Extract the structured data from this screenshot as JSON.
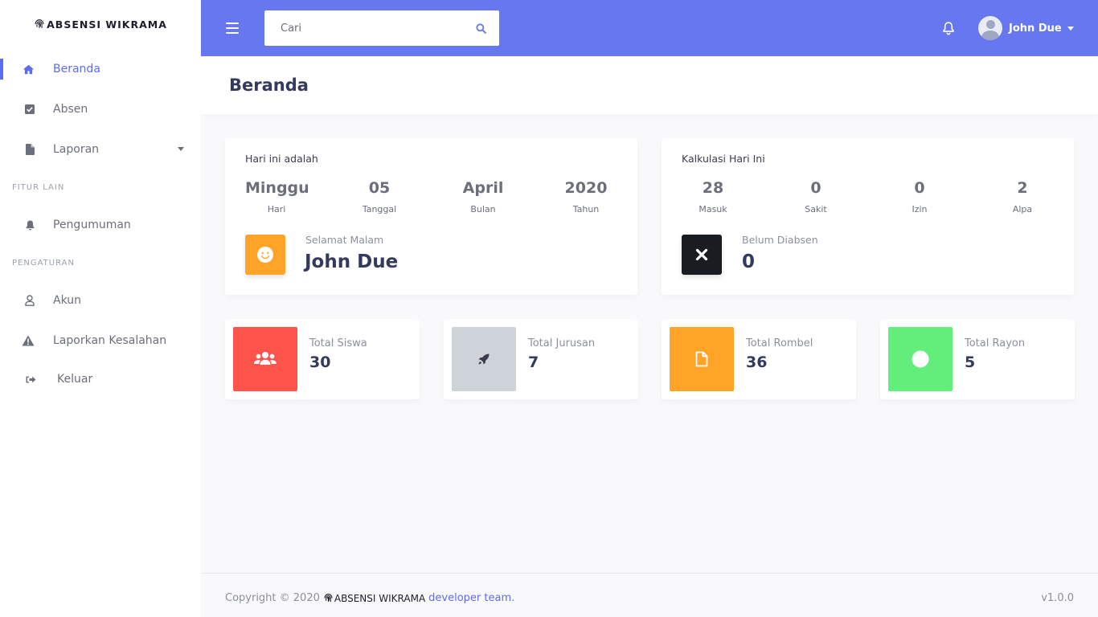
{
  "brand": {
    "name": "ABSENSI WIKRAMA"
  },
  "sidebar": {
    "items": [
      {
        "label": "Beranda",
        "icon": "home-icon",
        "active": true
      },
      {
        "label": "Absen",
        "icon": "check-square-icon"
      },
      {
        "label": "Laporan",
        "icon": "file-icon",
        "has_dropdown": true
      }
    ],
    "section_fitur": "FITUR LAIN",
    "fitur_items": [
      {
        "label": "Pengumuman",
        "icon": "bell-icon"
      }
    ],
    "section_pengaturan": "PENGATURAN",
    "pengaturan_items": [
      {
        "label": "Akun",
        "icon": "user-icon"
      },
      {
        "label": "Laporkan Kesalahan",
        "icon": "warning-icon"
      },
      {
        "label": "Keluar",
        "icon": "sign-out-icon"
      }
    ]
  },
  "topbar": {
    "search_placeholder": "Cari",
    "user_name": "John Due"
  },
  "page": {
    "title": "Beranda"
  },
  "today_card": {
    "title": "Hari ini adalah",
    "stats": [
      {
        "value": "Minggu",
        "label": "Hari"
      },
      {
        "value": "05",
        "label": "Tanggal"
      },
      {
        "value": "April",
        "label": "Bulan"
      },
      {
        "value": "2020",
        "label": "Tahun"
      }
    ],
    "greeting_label": "Selamat Malam",
    "greeting_name": "John Due"
  },
  "calc_card": {
    "title": "Kalkulasi Hari Ini",
    "stats": [
      {
        "value": "28",
        "label": "Masuk"
      },
      {
        "value": "0",
        "label": "Sakit"
      },
      {
        "value": "0",
        "label": "Izin"
      },
      {
        "value": "2",
        "label": "Alpa"
      }
    ],
    "pending_label": "Belum Diabsen",
    "pending_value": "0"
  },
  "totals": [
    {
      "title": "Total Siswa",
      "value": "30",
      "color": "#fc544b",
      "icon": "users-icon"
    },
    {
      "title": "Total Jurusan",
      "value": "7",
      "color": "#cdd3d8",
      "icon": "rocket-icon"
    },
    {
      "title": "Total Rombel",
      "value": "36",
      "color": "#ffa426",
      "icon": "file-icon"
    },
    {
      "title": "Total Rayon",
      "value": "5",
      "color": "#63ed7a",
      "icon": "circle-icon"
    }
  ],
  "footer": {
    "copyright": "Copyright © 2020",
    "brand": "ABSENSI WIKRAMA",
    "link": "developer team.",
    "version": "v1.0.0"
  },
  "colors": {
    "primary": "#6777ef",
    "greeting_icon": "#ffa426",
    "pending_icon": "#191d21"
  }
}
